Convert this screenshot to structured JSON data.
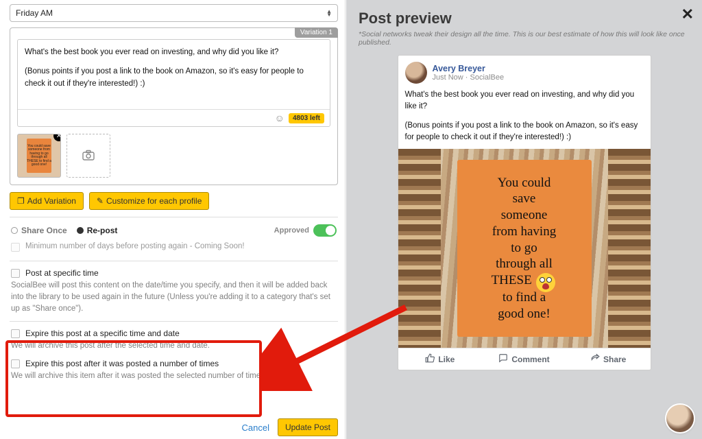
{
  "editor": {
    "schedule_select": "Friday AM",
    "variation_tab": "Variation 1",
    "post_text_line1": "What's the best book you ever read on investing, and why did you like it?",
    "post_text_line2": "(Bonus points if you post a link to the book on Amazon, so it's easy for people to check it out if they're interested!) :)",
    "char_counter": "4803 left",
    "add_variation_label": "Add Variation",
    "customize_label": "Customize for each profile",
    "share_once_label": "Share Once",
    "repost_label": "Re-post",
    "approved_label": "Approved",
    "min_days_label": "Minimum number of days before posting again - Coming Soon!",
    "specific_time_label": "Post at specific time",
    "specific_time_desc": "SocialBee will post this content on the date/time you specify, and then it will be added back into the library to be used again in the future (Unless you're adding it to a category that's set up as \"Share once\").",
    "expire_date_label": "Expire this post at a specific time and date",
    "expire_date_desc": "We will archive this post after the selected time and date.",
    "expire_count_label": "Expire this post after it was posted a number of times",
    "expire_count_desc": "We will archive this item after it was posted the selected number of times.",
    "cancel_label": "Cancel",
    "update_label": "Update Post"
  },
  "preview": {
    "title": "Post preview",
    "note": "*Social networks tweak their design all the time. This is our best estimate of how this will look like once published.",
    "author": "Avery Breyer",
    "meta_time": "Just Now",
    "meta_app": "SocialBee",
    "body_line1": "What's the best book you ever read on investing, and why did you like it?",
    "body_line2": "(Bonus points if you post a link to the book on Amazon, so it's easy for people to check it out if they're interested!) :)",
    "image_text": "You could save someone from having to go through all THESE 😱 to find a good one!",
    "image_line1": "You could",
    "image_line2": "save",
    "image_line3": "someone",
    "image_line4": "from having",
    "image_line5": "to go",
    "image_line6": "through all",
    "image_line7": "THESE",
    "image_line8": "to find a",
    "image_line9": "good one!",
    "like": "Like",
    "comment": "Comment",
    "share": "Share"
  }
}
